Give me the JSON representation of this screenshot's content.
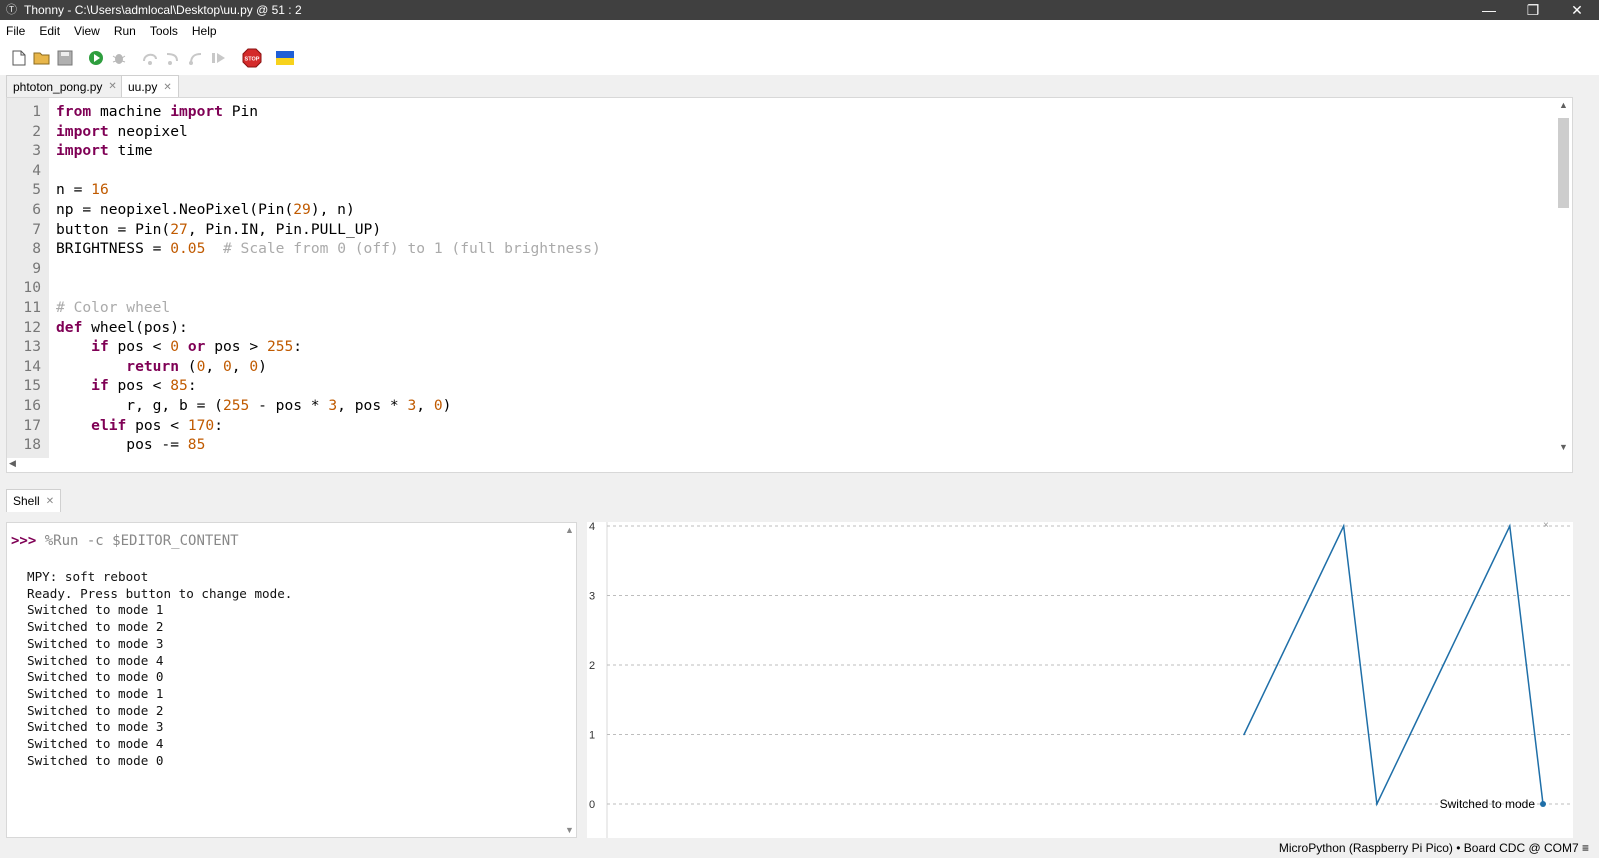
{
  "window": {
    "title": "Thonny  -  C:\\Users\\admlocal\\Desktop\\uu.py  @  51 : 2",
    "app_icon": "thonny-icon",
    "controls": [
      "minimize-icon",
      "restore-icon",
      "close-icon"
    ]
  },
  "menu": [
    "File",
    "Edit",
    "View",
    "Run",
    "Tools",
    "Help"
  ],
  "toolbar": {
    "buttons": [
      "new-file-icon",
      "open-folder-icon",
      "save-icon",
      "run-icon",
      "debug-icon",
      "step-over-icon",
      "step-into-icon",
      "step-out-icon",
      "resume-icon",
      "stop-icon",
      "ukraine-flag-icon"
    ],
    "stop_label": "STOP"
  },
  "tabs": [
    {
      "label": "phtoton_pong.py",
      "active": false
    },
    {
      "label": "uu.py",
      "active": true
    }
  ],
  "editor": {
    "lines": [
      {
        "n": "1",
        "code": "from machine import Pin"
      },
      {
        "n": "2",
        "code": "import neopixel"
      },
      {
        "n": "3",
        "code": "import time"
      },
      {
        "n": "4",
        "code": ""
      },
      {
        "n": "5",
        "code": "n = 16"
      },
      {
        "n": "6",
        "code": "np = neopixel.NeoPixel(Pin(29), n)"
      },
      {
        "n": "7",
        "code": "button = Pin(27, Pin.IN, Pin.PULL_UP)"
      },
      {
        "n": "8",
        "code": "BRIGHTNESS = 0.05  # Scale from 0 (off) to 1 (full brightness)"
      },
      {
        "n": "9",
        "code": ""
      },
      {
        "n": "10",
        "code": ""
      },
      {
        "n": "11",
        "code": "# Color wheel"
      },
      {
        "n": "12",
        "code": "def wheel(pos):"
      },
      {
        "n": "13",
        "code": "    if pos < 0 or pos > 255:"
      },
      {
        "n": "14",
        "code": "        return (0, 0, 0)"
      },
      {
        "n": "15",
        "code": "    if pos < 85:"
      },
      {
        "n": "16",
        "code": "        r, g, b = (255 - pos * 3, pos * 3, 0)"
      },
      {
        "n": "17",
        "code": "    elif pos < 170:"
      },
      {
        "n": "18",
        "code": "        pos -= 85"
      }
    ]
  },
  "shell": {
    "tab_label": "Shell",
    "prompt": ">>>",
    "command": "%Run -c $EDITOR_CONTENT",
    "output": [
      "MPY: soft reboot",
      "Ready. Press button to change mode.",
      "Switched to mode 1",
      "Switched to mode 2",
      "Switched to mode 3",
      "Switched to mode 4",
      "Switched to mode 0",
      "Switched to mode 1",
      "Switched to mode 2",
      "Switched to mode 3",
      "Switched to mode 4",
      "Switched to mode 0"
    ]
  },
  "chart_data": {
    "type": "line",
    "yticks": [
      "0",
      "1",
      "2",
      "3",
      "4"
    ],
    "ylim": [
      0,
      4
    ],
    "grid": true,
    "legend": "bottom-right",
    "series": [
      {
        "name": "Switched to mode",
        "color": "#1f6fa8",
        "values": [
          1,
          2,
          3,
          4,
          0,
          1,
          2,
          3,
          4,
          0
        ]
      }
    ]
  },
  "status": {
    "text": "MicroPython (Raspberry Pi Pico)  •  Board CDC @ COM7  ≡"
  }
}
